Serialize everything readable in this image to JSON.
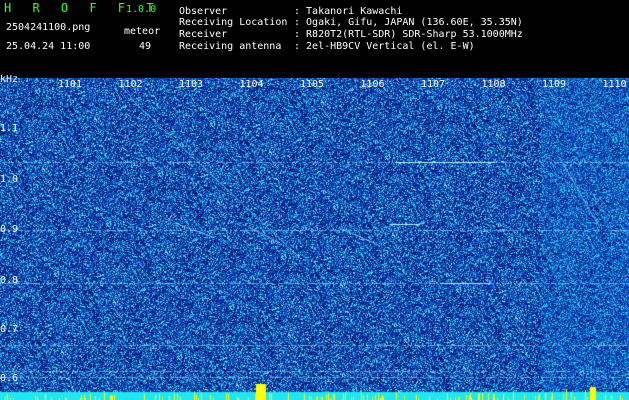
{
  "header": {
    "app_name": "H R O F F T",
    "version": "1.0.0",
    "filename": "2504241100.png",
    "mode_label": "meteor",
    "timestamp": "25.04.24 11:00",
    "count": "49",
    "info": [
      {
        "label": "Observer",
        "value": ": Takanori Kawachi"
      },
      {
        "label": "Receiving Location",
        "value": ": Ogaki, Gifu, JAPAN (136.60E, 35.35N)"
      },
      {
        "label": "Receiver",
        "value": ": R820T2(RTL-SDR) SDR-Sharp 53.1000MHz"
      },
      {
        "label": "Receiving antenna",
        "value": ": 2el-HB9CV Vertical (el. E-W)"
      }
    ]
  },
  "chart_data": {
    "type": "heatmap",
    "ylabel": "kHz",
    "y_ticks": [
      "1.1",
      "1.0",
      "0.9",
      "0.8",
      "0.7",
      "0.6"
    ],
    "x_ticks": [
      "1101",
      "1102",
      "1103",
      "1104",
      "1105",
      "1106",
      "1107",
      "1108",
      "1109",
      "1110"
    ],
    "colors": {
      "background": "#000000",
      "noise_low": "#0a1a8a",
      "noise_high": "#4ec9ff",
      "signal": "#ffff00"
    }
  }
}
